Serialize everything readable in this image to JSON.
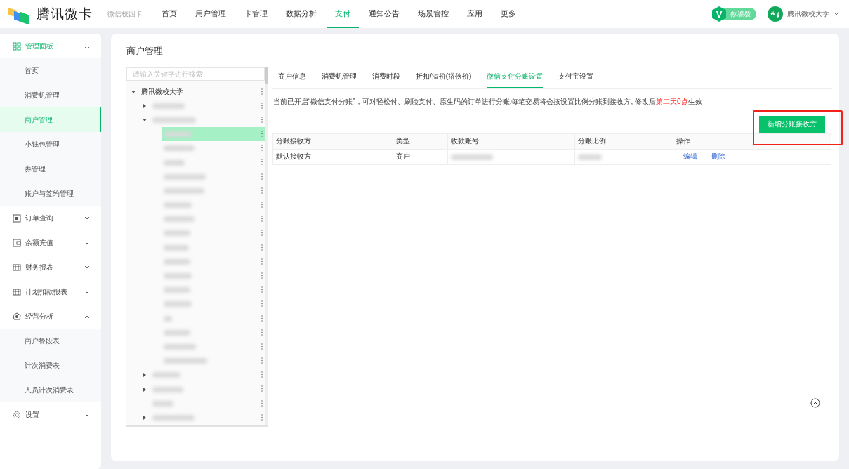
{
  "header": {
    "brand": "腾讯微卡",
    "subtitle": "微信校园卡",
    "nav": [
      {
        "label": "首页",
        "selected": false
      },
      {
        "label": "用户管理",
        "selected": false
      },
      {
        "label": "卡管理",
        "selected": false
      },
      {
        "label": "数据分析",
        "selected": false
      },
      {
        "label": "支付",
        "selected": true
      },
      {
        "label": "通知公告",
        "selected": false
      },
      {
        "label": "场景管控",
        "selected": false
      },
      {
        "label": "应用",
        "selected": false
      },
      {
        "label": "更多",
        "selected": false
      }
    ],
    "edition_badge": {
      "letter": "V",
      "label": "标准版"
    },
    "user": {
      "name": "腾讯微校大学"
    }
  },
  "sidebar": {
    "groups": [
      {
        "label": "管理面板",
        "selected": true,
        "expanded": true,
        "items": [
          {
            "label": "首页",
            "selected": false
          },
          {
            "label": "消费机管理",
            "selected": false
          },
          {
            "label": "商户管理",
            "selected": true
          },
          {
            "label": "小钱包管理",
            "selected": false
          },
          {
            "label": "券管理",
            "selected": false
          },
          {
            "label": "账户与签约管理",
            "selected": false
          }
        ]
      },
      {
        "label": "订单查询",
        "selected": false,
        "expanded": false
      },
      {
        "label": "余额充值",
        "selected": false,
        "expanded": false
      },
      {
        "label": "财务报表",
        "selected": false,
        "expanded": false
      },
      {
        "label": "计划扣款报表",
        "selected": false,
        "expanded": false
      },
      {
        "label": "经营分析",
        "selected": false,
        "expanded": true,
        "items": [
          {
            "label": "商户餐段表",
            "selected": false
          },
          {
            "label": "计次消费表",
            "selected": false
          },
          {
            "label": "人员计次消费表",
            "selected": false
          }
        ]
      },
      {
        "label": "设置",
        "selected": false,
        "expanded": false
      }
    ]
  },
  "page": {
    "title": "商户管理",
    "tree": {
      "search_placeholder": "请输入关键字进行搜索",
      "root": {
        "label": "腾讯微校大学",
        "expanded": true,
        "children": [
          {
            "kind": "branch",
            "expanded": false,
            "selected": false
          },
          {
            "kind": "branch",
            "expanded": true,
            "selected": false,
            "children": [
              {
                "kind": "leaf",
                "selected": true
              },
              {
                "kind": "leaf",
                "selected": false
              },
              {
                "kind": "leaf",
                "selected": false
              },
              {
                "kind": "leaf",
                "selected": false
              },
              {
                "kind": "leaf",
                "selected": false
              },
              {
                "kind": "leaf",
                "selected": false
              },
              {
                "kind": "leaf",
                "selected": false
              },
              {
                "kind": "leaf",
                "selected": false
              },
              {
                "kind": "leaf",
                "selected": false
              },
              {
                "kind": "leaf",
                "selected": false
              },
              {
                "kind": "leaf",
                "selected": false
              },
              {
                "kind": "leaf",
                "selected": false
              },
              {
                "kind": "leaf",
                "selected": false
              },
              {
                "kind": "leaf",
                "selected": false
              },
              {
                "kind": "leaf",
                "selected": false
              },
              {
                "kind": "leaf",
                "selected": false
              },
              {
                "kind": "leaf",
                "selected": false
              }
            ]
          },
          {
            "kind": "branch",
            "expanded": false,
            "selected": false
          },
          {
            "kind": "branch",
            "expanded": false,
            "selected": false
          },
          {
            "kind": "leaf",
            "selected": false
          },
          {
            "kind": "branch",
            "expanded": false,
            "selected": false
          }
        ]
      }
    },
    "tabs": [
      {
        "label": "商户信息",
        "selected": false
      },
      {
        "label": "消费机管理",
        "selected": false
      },
      {
        "label": "消费时段",
        "selected": false
      },
      {
        "label": "折扣/溢价(搭伙价)",
        "selected": false
      },
      {
        "label": "微信支付分账设置",
        "selected": true
      },
      {
        "label": "支付宝设置",
        "selected": false
      }
    ],
    "notice": {
      "text": "当前已开启“微信支付分账”，可对轻松付、刷脸支付、原生码的订单进行分账,每笔交易将会按设置比例分账到接收方, 修改后",
      "highlight": "第二天0点",
      "tail": "生效"
    },
    "add_button": "新增分账接收方",
    "table": {
      "columns": [
        "分账接收方",
        "类型",
        "收款账号",
        "分账比例",
        "操作"
      ],
      "rows": [
        {
          "receiver": "默认接收方",
          "type": "商户",
          "actions": [
            "编辑",
            "删除"
          ]
        }
      ]
    }
  }
}
